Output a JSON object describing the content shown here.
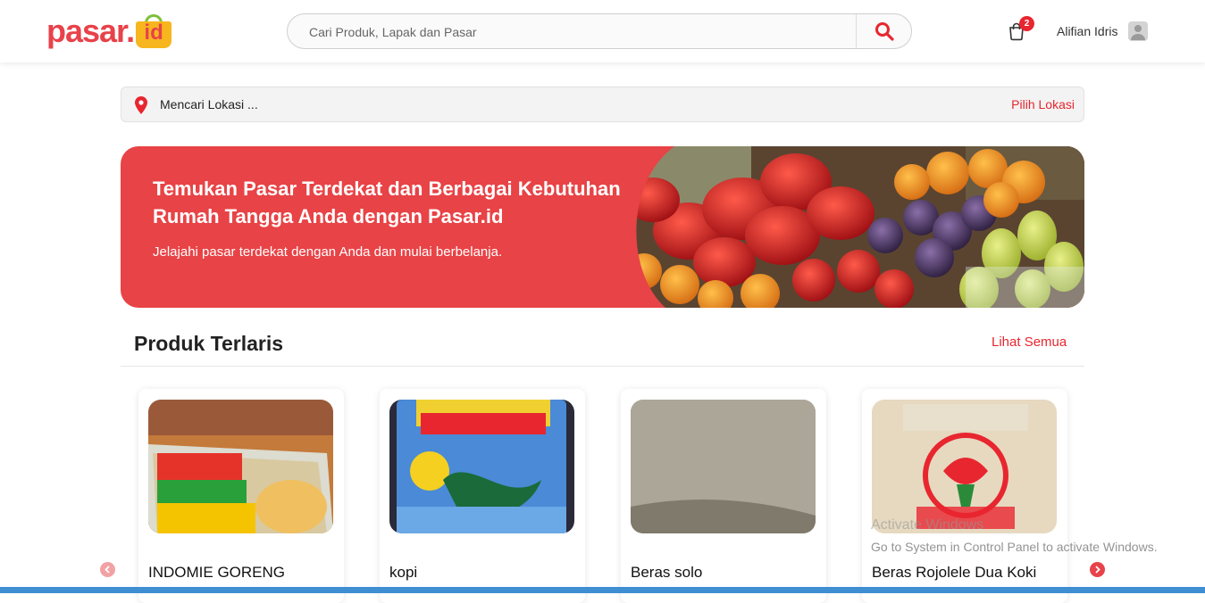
{
  "header": {
    "logo_text": "pasar.",
    "logo_badge": "id",
    "search_placeholder": "Cari Produk, Lapak dan Pasar",
    "cart_count": "2",
    "user_name": "Alifian Idris"
  },
  "location": {
    "status": "Mencari Lokasi ...",
    "action": "Pilih Lokasi"
  },
  "hero": {
    "title": "Temukan Pasar Terdekat dan Berbagai Kebutuhan Rumah Tangga Anda dengan Pasar.id",
    "subtitle": "Jelajahi pasar terdekat dengan Anda dan mulai berbelanja."
  },
  "section": {
    "title": "Produk Terlaris",
    "see_all": "Lihat Semua"
  },
  "products": [
    {
      "name": "INDOMIE GORENG"
    },
    {
      "name": "kopi"
    },
    {
      "name": "Beras solo"
    },
    {
      "name": "Beras Rojolele Dua Koki"
    }
  ],
  "watermark": {
    "line1": "Activate Windows",
    "line2": "Go to System in Control Panel to activate Windows."
  },
  "colors": {
    "brand_red": "#e8424a",
    "accent_red": "#e8262f"
  }
}
